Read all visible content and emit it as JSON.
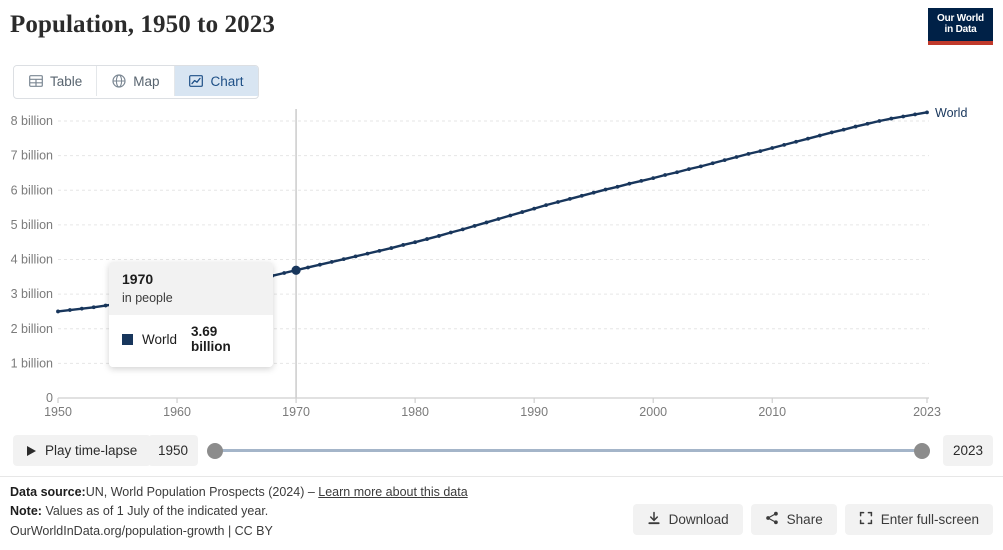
{
  "header": {
    "title": "Population, 1950 to 2023",
    "logo_line1": "Our World",
    "logo_line2": "in Data",
    "logo_color": "#002147",
    "logo_accent": "#c0392b"
  },
  "tabs": [
    {
      "label": "Table",
      "icon": "table-icon",
      "active": false
    },
    {
      "label": "Map",
      "icon": "globe-icon",
      "active": false
    },
    {
      "label": "Chart",
      "icon": "line-chart-icon",
      "active": true
    }
  ],
  "tooltip": {
    "year": "1970",
    "unit": "in people",
    "series": "World",
    "value": "3.69 billion",
    "swatch_color": "#18365c"
  },
  "timeline": {
    "play_label": "Play time-lapse",
    "start_year": "1950",
    "end_year": "2023"
  },
  "footer": {
    "source_label": "Data source:",
    "source_text": "UN, World Population Prospects (2024) – ",
    "source_link": "Learn more about this data",
    "note_label": "Note:",
    "note_text": "Values as of 1 July of the indicated year.",
    "attribution": "OurWorldInData.org/population-growth | CC BY",
    "buttons": [
      {
        "label": "Download",
        "icon": "download-icon"
      },
      {
        "label": "Share",
        "icon": "share-icon"
      },
      {
        "label": "Enter full-screen",
        "icon": "fullscreen-icon"
      }
    ]
  },
  "chart_data": {
    "type": "line",
    "title": "Population, 1950 to 2023",
    "xlabel": "",
    "ylabel": "",
    "unit": "in people",
    "grid": true,
    "legend_position": "line-end-label",
    "xlim": [
      1950,
      2023
    ],
    "ylim": [
      0,
      8
    ],
    "y_tick_labels": [
      "0",
      "1 billion",
      "2 billion",
      "3 billion",
      "4 billion",
      "5 billion",
      "6 billion",
      "7 billion",
      "8 billion"
    ],
    "y_tick_values": [
      0,
      1,
      2,
      3,
      4,
      5,
      6,
      7,
      8
    ],
    "x_tick_labels": [
      "1950",
      "1960",
      "1970",
      "1980",
      "1990",
      "2000",
      "2010",
      "2023"
    ],
    "x_tick_values": [
      1950,
      1960,
      1970,
      1980,
      1990,
      2000,
      2010,
      2023
    ],
    "series": [
      {
        "name": "World",
        "color": "#18365c",
        "end_label": "World",
        "x": [
          1950,
          1951,
          1952,
          1953,
          1954,
          1955,
          1956,
          1957,
          1958,
          1959,
          1960,
          1961,
          1962,
          1963,
          1964,
          1965,
          1966,
          1967,
          1968,
          1969,
          1970,
          1971,
          1972,
          1973,
          1974,
          1975,
          1976,
          1977,
          1978,
          1979,
          1980,
          1981,
          1982,
          1983,
          1984,
          1985,
          1986,
          1987,
          1988,
          1989,
          1990,
          1991,
          1992,
          1993,
          1994,
          1995,
          1996,
          1997,
          1998,
          1999,
          2000,
          2001,
          2002,
          2003,
          2004,
          2005,
          2006,
          2007,
          2008,
          2009,
          2010,
          2011,
          2012,
          2013,
          2014,
          2015,
          2016,
          2017,
          2018,
          2019,
          2020,
          2021,
          2022,
          2023
        ],
        "y": [
          2.5,
          2.54,
          2.58,
          2.62,
          2.67,
          2.72,
          2.77,
          2.82,
          2.87,
          2.92,
          2.98,
          3.04,
          3.1,
          3.17,
          3.24,
          3.31,
          3.38,
          3.45,
          3.53,
          3.61,
          3.69,
          3.77,
          3.85,
          3.93,
          4.01,
          4.09,
          4.17,
          4.25,
          4.33,
          4.42,
          4.5,
          4.59,
          4.68,
          4.78,
          4.87,
          4.97,
          5.07,
          5.17,
          5.27,
          5.37,
          5.47,
          5.57,
          5.66,
          5.75,
          5.84,
          5.93,
          6.02,
          6.1,
          6.19,
          6.27,
          6.35,
          6.44,
          6.52,
          6.61,
          6.69,
          6.78,
          6.87,
          6.96,
          7.05,
          7.13,
          7.22,
          7.31,
          7.4,
          7.49,
          7.58,
          7.67,
          7.75,
          7.84,
          7.92,
          8.0,
          8.07,
          8.13,
          8.19,
          8.25
        ],
        "highlight_point": {
          "x": 1970,
          "y": 3.69
        }
      }
    ]
  }
}
